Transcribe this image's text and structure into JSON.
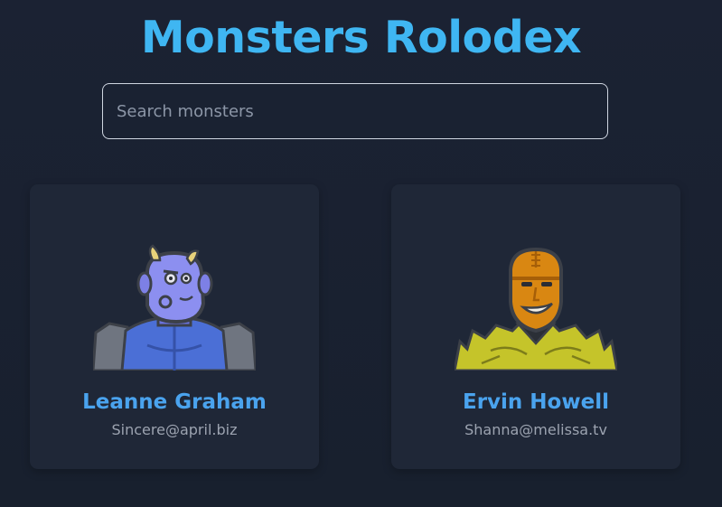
{
  "header": {
    "title": "Monsters Rolodex"
  },
  "search": {
    "placeholder": "Search monsters",
    "value": ""
  },
  "monsters": [
    {
      "name": "Leanne Graham",
      "email": "Sincere@april.biz",
      "avatar_icon": "blue-horned-monster-icon"
    },
    {
      "name": "Ervin Howell",
      "email": "Shanna@melissa.tv",
      "avatar_icon": "orange-spiky-monster-icon"
    }
  ],
  "colors": {
    "background": "#19202f",
    "card": "#1f2737",
    "title": "#3fb6f2",
    "name": "#4aa3ee",
    "email": "#9ca3b0"
  }
}
